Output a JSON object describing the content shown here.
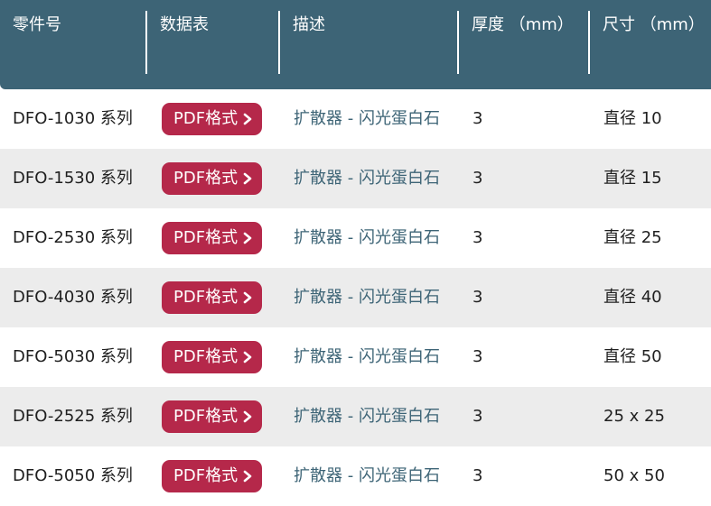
{
  "headers": {
    "part_number": "零件号",
    "datasheet": "数据表",
    "description": "描述",
    "thickness": "厚度 （mm）",
    "size": "尺寸 （mm）"
  },
  "rows": [
    {
      "part": "DFO-1030 系列",
      "pdf": "PDF格式",
      "desc": "扩散器 - 闪光蛋白石",
      "thickness": "3",
      "size": "直径 10"
    },
    {
      "part": "DFO-1530 系列",
      "pdf": "PDF格式",
      "desc": "扩散器 - 闪光蛋白石",
      "thickness": "3",
      "size": "直径 15"
    },
    {
      "part": "DFO-2530 系列",
      "pdf": "PDF格式",
      "desc": "扩散器 - 闪光蛋白石",
      "thickness": "3",
      "size": "直径 25"
    },
    {
      "part": "DFO-4030 系列",
      "pdf": "PDF格式",
      "desc": "扩散器 - 闪光蛋白石",
      "thickness": "3",
      "size": "直径 40"
    },
    {
      "part": "DFO-5030 系列",
      "pdf": "PDF格式",
      "desc": "扩散器 - 闪光蛋白石",
      "thickness": "3",
      "size": "直径 50"
    },
    {
      "part": "DFO-2525 系列",
      "pdf": "PDF格式",
      "desc": "扩散器 - 闪光蛋白石",
      "thickness": "3",
      "size": "25 x 25"
    },
    {
      "part": "DFO-5050 系列",
      "pdf": "PDF格式",
      "desc": "扩散器 - 闪光蛋白石",
      "thickness": "3",
      "size": "50 x 50"
    }
  ],
  "colors": {
    "header_bg": "#3d6476",
    "button_bg": "#b5284a",
    "alt_row_bg": "#ececec",
    "description_text": "#3d6476"
  },
  "icons": {
    "button_icon": "chevron-right-icon"
  }
}
